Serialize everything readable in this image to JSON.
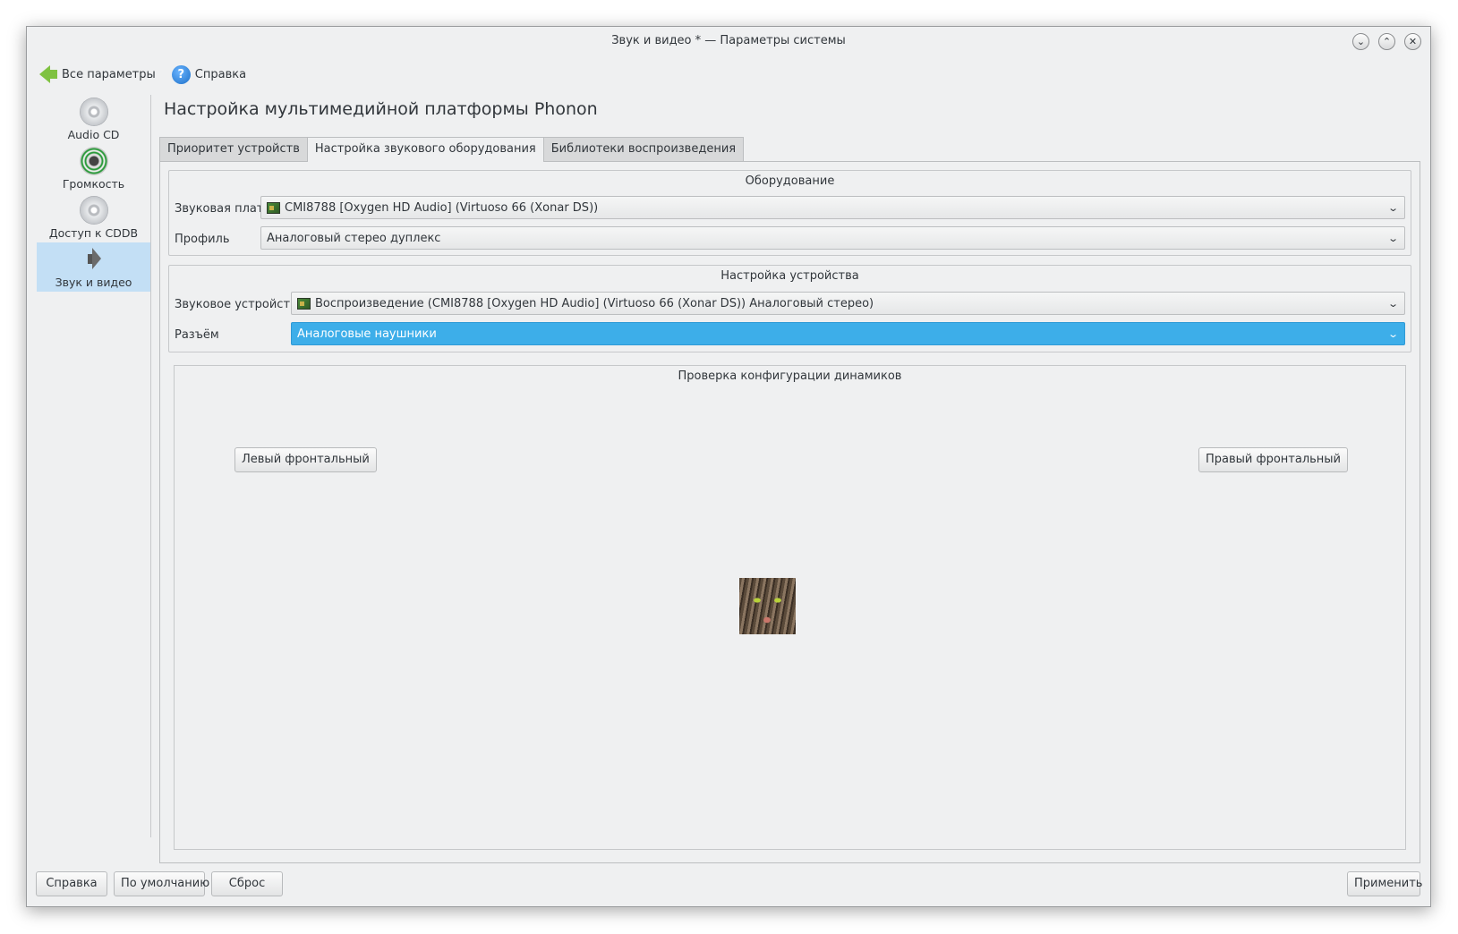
{
  "window": {
    "title": "Звук и видео * — Параметры системы",
    "buttons": {
      "minimize": "⌄",
      "maximize": "⌃",
      "close": "✕"
    }
  },
  "toolbar": {
    "back_label": "Все параметры",
    "help_label": "Справка"
  },
  "sidebar": {
    "items": [
      {
        "label": "Audio CD",
        "icon": "cd-icon"
      },
      {
        "label": "Громкость",
        "icon": "volume-icon"
      },
      {
        "label": "Доступ к CDDB",
        "icon": "cd-icon"
      },
      {
        "label": "Звук и видео",
        "icon": "speaker-icon",
        "active": true
      }
    ]
  },
  "page": {
    "title": "Настройка мультимедийной платформы Phonon",
    "tabs": [
      {
        "label": "Приоритет устройств"
      },
      {
        "label": "Настройка звукового оборудования",
        "active": true
      },
      {
        "label": "Библиотеки воспроизведения"
      }
    ]
  },
  "hardware": {
    "title": "Оборудование",
    "card_label": "Звуковая плата",
    "card_value": "CMI8788 [Oxygen HD Audio] (Virtuoso 66 (Xonar DS))",
    "profile_label": "Профиль",
    "profile_value": "Аналоговый стерео дуплекс"
  },
  "device": {
    "title": "Настройка устройства",
    "device_label": "Звуковое устройство",
    "device_value": "Воспроизведение (CMI8788 [Oxygen HD Audio] (Virtuoso 66 (Xonar DS)) Аналоговый стерео)",
    "port_label": "Разъём",
    "port_value": "Аналоговые наушники"
  },
  "speakers": {
    "title": "Проверка конфигурации динамиков",
    "left_label": "Левый фронтальный",
    "right_label": "Правый фронтальный"
  },
  "footer": {
    "help": "Справка",
    "defaults": "По умолчанию",
    "reset": "Сброс",
    "apply": "Применить"
  },
  "colors": {
    "accent": "#3daee9",
    "window_bg": "#eff0f1",
    "sidebar_active": "#c3dff5"
  }
}
